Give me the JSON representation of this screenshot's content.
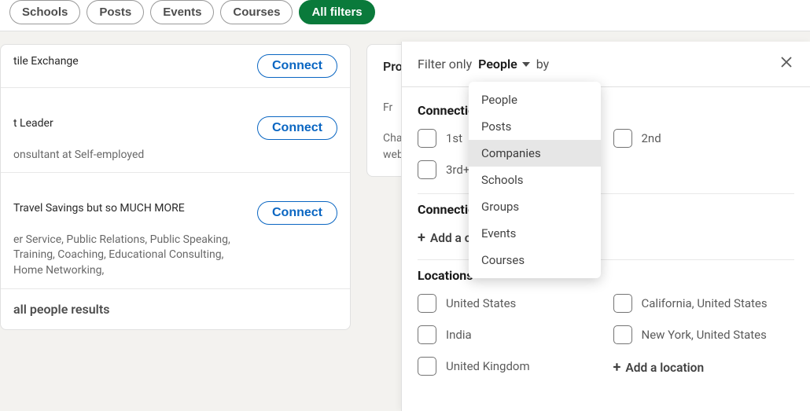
{
  "filterBar": {
    "pills": [
      "Schools",
      "Posts",
      "Events",
      "Courses"
    ],
    "allFilters": "All filters"
  },
  "results": [
    {
      "title": "tile Exchange",
      "meta": "",
      "cta": "Connect"
    },
    {
      "title": "t Leader",
      "meta": "onsultant at Self-employed",
      "cta": "Connect"
    },
    {
      "title": "Travel Savings but so MUCH MORE",
      "meta": "er Service, Public Relations, Public Speaking, Training, Coaching, Educational Consulting, Home Networking,",
      "cta": "Connect"
    }
  ],
  "seeAll": "all people results",
  "promo": {
    "title": "Pro",
    "line1": "Fr",
    "line2": "Chan",
    "line3": "webs"
  },
  "filterPanel": {
    "label1": "Filter only",
    "selectValue": "People",
    "label2": "by",
    "sections": {
      "connections": {
        "title": "Connections",
        "opts": [
          "1st",
          "2nd",
          "3rd+"
        ]
      },
      "connectionsOf": {
        "title": "Connections of",
        "add": "Add a connection"
      },
      "locations": {
        "title": "Locations",
        "opts": [
          "United States",
          "California, United States",
          "India",
          "New York, United States",
          "United Kingdom"
        ],
        "add": "Add a location"
      }
    }
  },
  "dropdown": [
    "People",
    "Posts",
    "Companies",
    "Schools",
    "Groups",
    "Events",
    "Courses"
  ],
  "dropdownHighlightIndex": 2
}
